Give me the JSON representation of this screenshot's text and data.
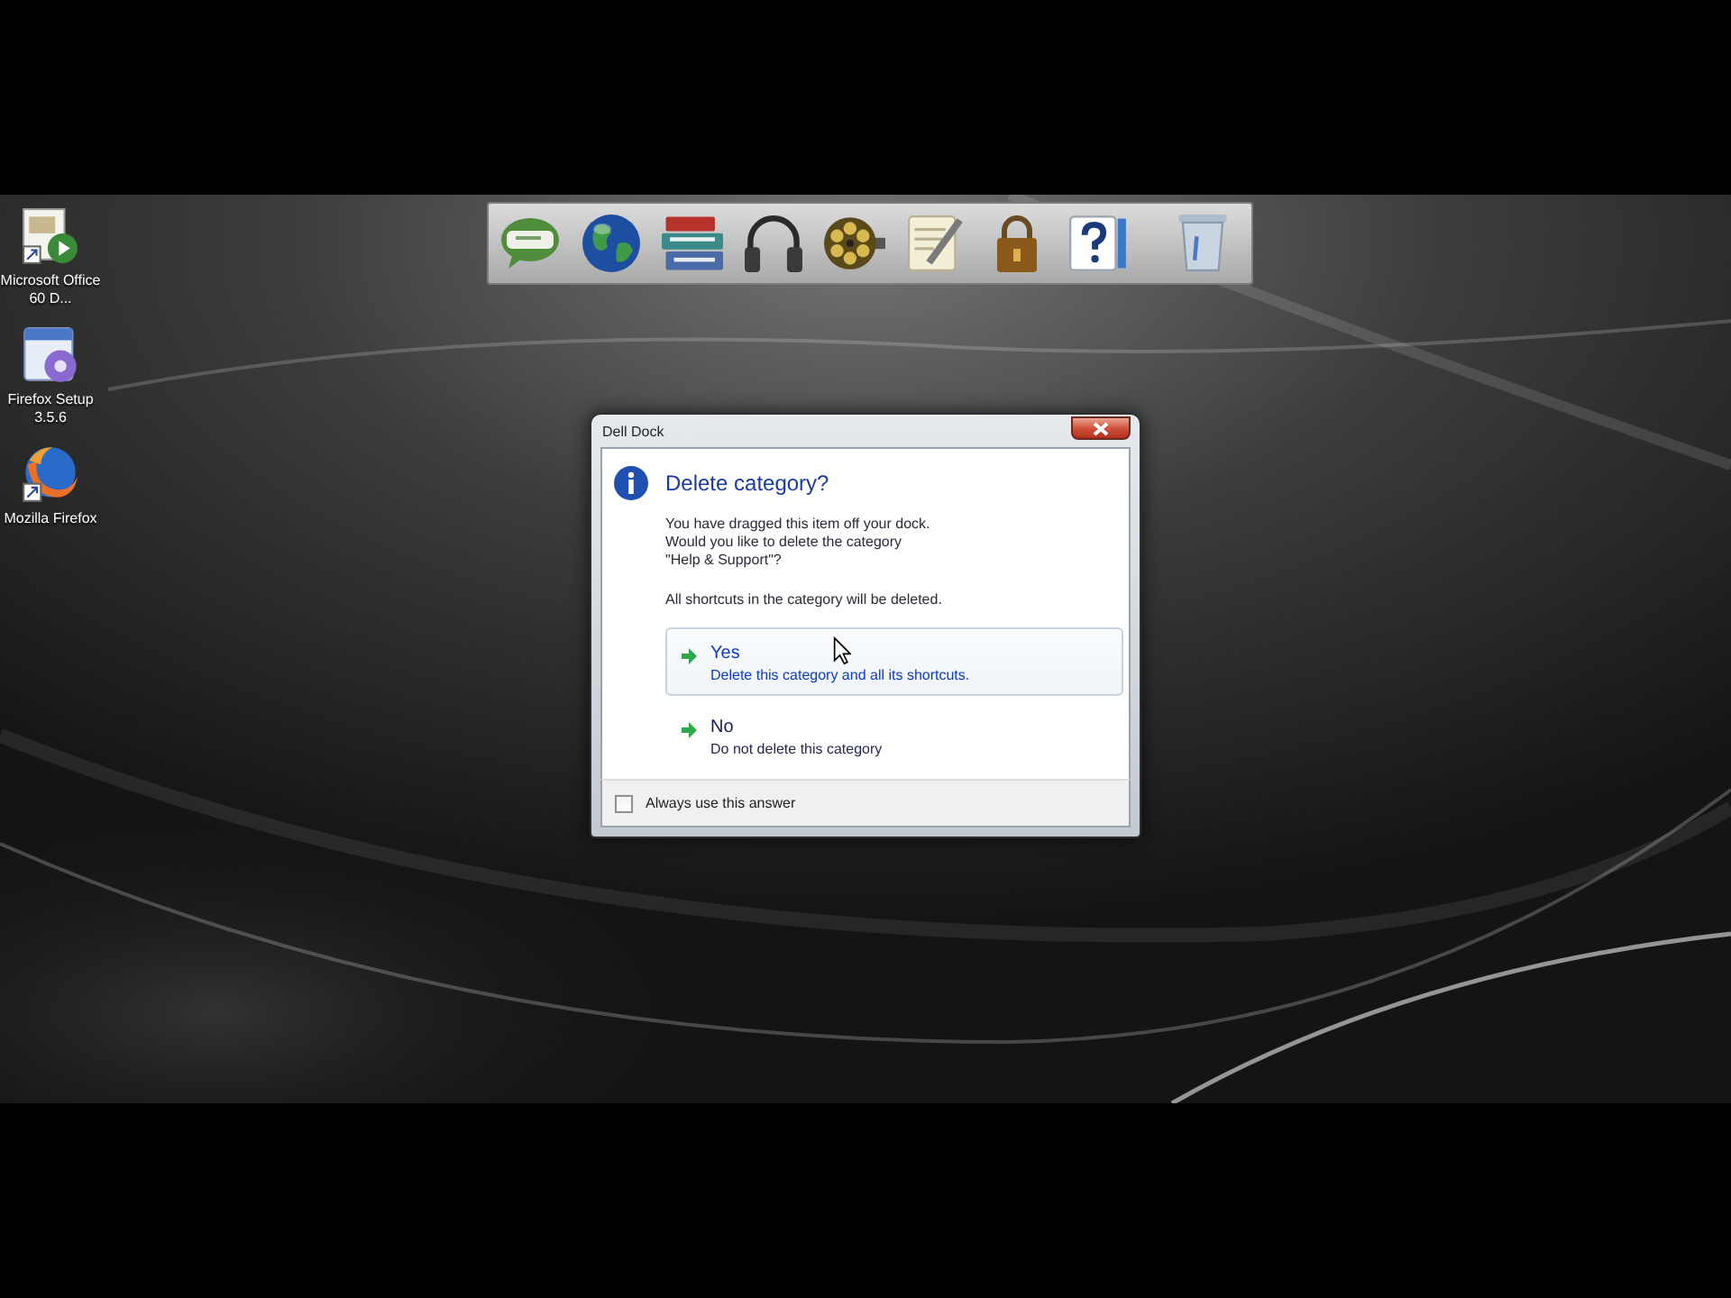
{
  "desktop_icons": [
    {
      "kind": "document",
      "label": "Microsoft Office 60 D..."
    },
    {
      "kind": "installer",
      "label": "Firefox Setup 3.5.6"
    },
    {
      "kind": "browser",
      "label": "Mozilla Firefox"
    }
  ],
  "dock": {
    "items": [
      {
        "kind": "chat"
      },
      {
        "kind": "globe"
      },
      {
        "kind": "books"
      },
      {
        "kind": "headphones"
      },
      {
        "kind": "reel"
      },
      {
        "kind": "notes"
      },
      {
        "kind": "padlock"
      },
      {
        "kind": "help"
      },
      {
        "kind": "trash"
      }
    ]
  },
  "dialog": {
    "title": "Dell Dock",
    "heading": "Delete category?",
    "message": "You have dragged this item off your dock.\nWould you like to delete the category\n\"Help & Support\"?",
    "note": "All shortcuts in the category will be deleted.",
    "options": [
      {
        "label": "Yes",
        "description": "Delete this category and all its shortcuts.",
        "selected": true
      },
      {
        "label": "No",
        "description": "Do not delete this category",
        "selected": false
      }
    ],
    "footer_checkbox": {
      "label": "Always use this answer",
      "checked": false
    }
  }
}
